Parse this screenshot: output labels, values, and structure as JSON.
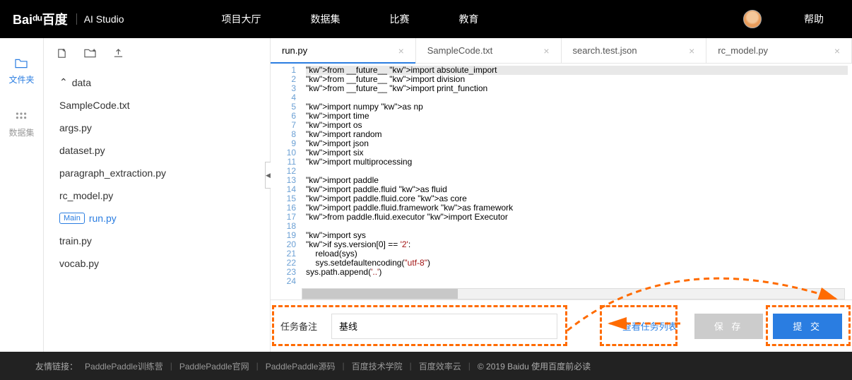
{
  "header": {
    "brand_main": "Baiᵈᵘ百度",
    "brand_sub": "AI Studio",
    "nav": [
      "项目大厅",
      "数据集",
      "比赛",
      "教育"
    ],
    "help": "帮助"
  },
  "leftrail": {
    "files": "文件夹",
    "datasets": "数据集"
  },
  "filetree": {
    "folder": "data",
    "items": [
      "SampleCode.txt",
      "args.py",
      "dataset.py",
      "paragraph_extraction.py",
      "rc_model.py",
      "run.py",
      "train.py",
      "vocab.py"
    ],
    "active": "run.py",
    "main_badge": "Main"
  },
  "tabs": [
    {
      "label": "run.py",
      "active": true
    },
    {
      "label": "SampleCode.txt",
      "active": false
    },
    {
      "label": "search.test.json",
      "active": false
    },
    {
      "label": "rc_model.py",
      "active": false
    }
  ],
  "code_lines": [
    {
      "n": 1,
      "t": "from __future__ import absolute_import"
    },
    {
      "n": 2,
      "t": "from __future__ import division"
    },
    {
      "n": 3,
      "t": "from __future__ import print_function"
    },
    {
      "n": 4,
      "t": ""
    },
    {
      "n": 5,
      "t": "import numpy as np"
    },
    {
      "n": 6,
      "t": "import time"
    },
    {
      "n": 7,
      "t": "import os"
    },
    {
      "n": 8,
      "t": "import random"
    },
    {
      "n": 9,
      "t": "import json"
    },
    {
      "n": 10,
      "t": "import six"
    },
    {
      "n": 11,
      "t": "import multiprocessing"
    },
    {
      "n": 12,
      "t": ""
    },
    {
      "n": 13,
      "t": "import paddle"
    },
    {
      "n": 14,
      "t": "import paddle.fluid as fluid"
    },
    {
      "n": 15,
      "t": "import paddle.fluid.core as core"
    },
    {
      "n": 16,
      "t": "import paddle.fluid.framework as framework"
    },
    {
      "n": 17,
      "t": "from paddle.fluid.executor import Executor"
    },
    {
      "n": 18,
      "t": ""
    },
    {
      "n": 19,
      "t": "import sys"
    },
    {
      "n": 20,
      "t": "if sys.version[0] == '2':"
    },
    {
      "n": 21,
      "t": "    reload(sys)"
    },
    {
      "n": 22,
      "t": "    sys.setdefaultencoding(\"utf-8\")"
    },
    {
      "n": 23,
      "t": "sys.path.append('..')"
    },
    {
      "n": 24,
      "t": ""
    }
  ],
  "bottombar": {
    "task_label": "任务备注",
    "task_value": "基线",
    "view_link": "查看任务列表",
    "save": "保 存",
    "submit": "提 交"
  },
  "footer": {
    "lead": "友情链接：",
    "links": [
      "PaddlePaddle训练营",
      "PaddlePaddle官网",
      "PaddlePaddle源码",
      "百度技术学院",
      "百度效率云"
    ],
    "copyright": "© 2019 Baidu 使用百度前必读"
  }
}
